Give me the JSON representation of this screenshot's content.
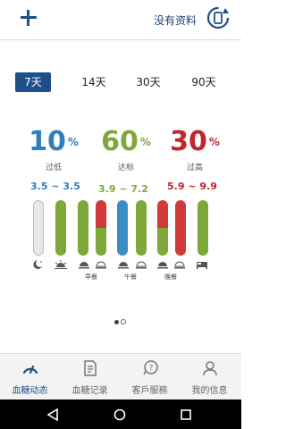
{
  "header": {
    "no_data_label": "没有资料"
  },
  "period_tabs": [
    "7天",
    "14天",
    "30天",
    "90天"
  ],
  "stats": [
    {
      "pct": "10",
      "unit": "%",
      "label": "过低",
      "color": "#2f7fbf",
      "range": "3.5 ~ 3.5"
    },
    {
      "pct": "60",
      "unit": "%",
      "label": "达标",
      "color": "#7ea83a",
      "range": "3.9 ~ 7.2"
    },
    {
      "pct": "30",
      "unit": "%",
      "label": "过高",
      "color": "#c0262b",
      "range": "5.9 ~ 9.9"
    }
  ],
  "bar_colors": {
    "blue": "#3a8cc4",
    "green": "#7ea83a",
    "red": "#cf3a3a",
    "empty": "#e8e8e8"
  },
  "bars": [
    {
      "icon": "moon-icon",
      "low": 0,
      "target": 0,
      "high": 0
    },
    {
      "icon": "sunrise-icon",
      "low": 0,
      "target": 1.0,
      "high": 0
    },
    {
      "icon": "plate-icon",
      "low": 0,
      "target": 1.0,
      "high": 0
    },
    {
      "icon": "plate-after-icon",
      "low": 0,
      "target": 0.5,
      "high": 0.5
    },
    {
      "icon": "plate-icon",
      "low": 1.0,
      "target": 0,
      "high": 0
    },
    {
      "icon": "plate-after-icon",
      "low": 0,
      "target": 1.0,
      "high": 0
    },
    {
      "icon": "plate-icon",
      "low": 0,
      "target": 0.5,
      "high": 0.5
    },
    {
      "icon": "plate-after-icon",
      "low": 0,
      "target": 0.0,
      "high": 1.0
    },
    {
      "icon": "bed-icon",
      "low": 0,
      "target": 1.0,
      "high": 0
    }
  ],
  "meal_labels": [
    "早餐",
    "午餐",
    "晚餐"
  ],
  "pager": {
    "current": 1,
    "total": 2
  },
  "bottom_nav": [
    {
      "label": "血糖动态",
      "icon": "gauge-icon",
      "active": true
    },
    {
      "label": "血糖记录",
      "icon": "document-icon",
      "active": false
    },
    {
      "label": "客戶服務",
      "icon": "support-icon",
      "active": false
    },
    {
      "label": "我的信息",
      "icon": "person-icon",
      "active": false
    }
  ]
}
